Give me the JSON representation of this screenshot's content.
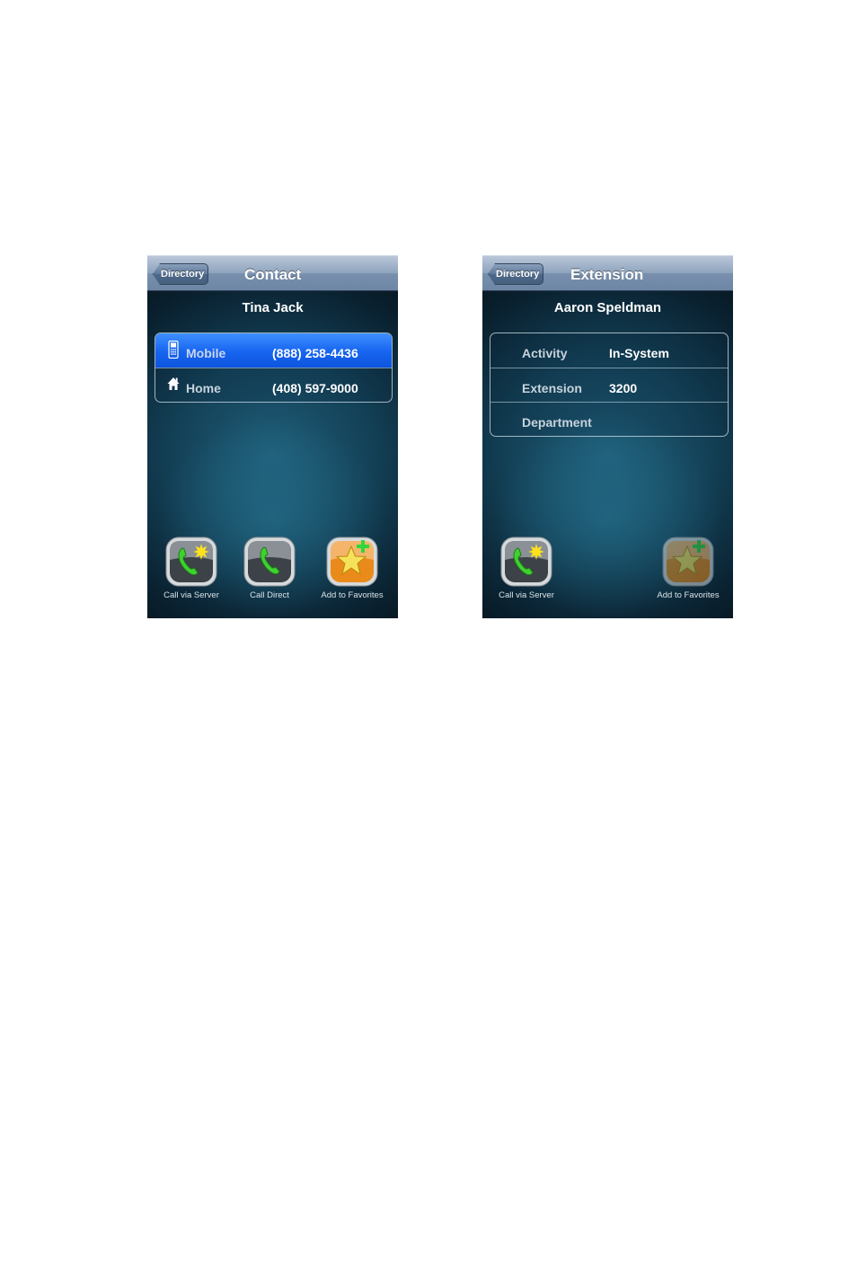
{
  "screens": [
    {
      "id": "contact",
      "back_label": "Directory",
      "title": "Contact",
      "person_name": "Tina Jack",
      "rows": [
        {
          "label": "Mobile",
          "value": "(888) 258-4436",
          "icon": "mobile-phone-icon",
          "selected": true
        },
        {
          "label": "Home",
          "value": "(408) 597-9000",
          "icon": "home-icon",
          "selected": false
        }
      ],
      "actions": [
        {
          "label": "Call via Server",
          "icon": "call-via-server-icon"
        },
        {
          "label": "Call Direct",
          "icon": "call-direct-icon"
        },
        {
          "label": "Add to Favorites",
          "icon": "add-favorite-star-icon"
        }
      ]
    },
    {
      "id": "extension",
      "back_label": "Directory",
      "title": "Extension",
      "person_name": "Aaron Speldman",
      "rows": [
        {
          "label": "Activity",
          "value": "In-System"
        },
        {
          "label": "Extension",
          "value": "3200"
        },
        {
          "label": "Department",
          "value": ""
        }
      ],
      "actions": [
        {
          "label": "Call via Server",
          "icon": "call-via-server-icon"
        },
        {
          "label": "Add to Favorites",
          "icon": "add-favorite-star-icon",
          "dimmed": true
        }
      ]
    }
  ],
  "colors": {
    "navbar": "#7f97b4",
    "selected_row": "#1664f0",
    "phone_green": "#3fd12f",
    "favorite_orange": "#e98a1a"
  }
}
